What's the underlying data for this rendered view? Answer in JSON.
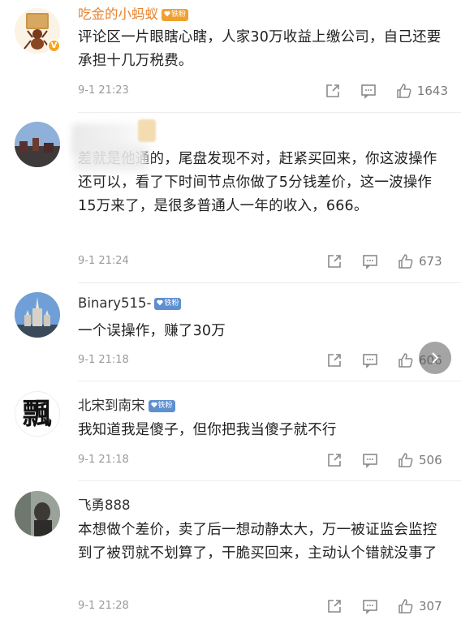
{
  "comments": [
    {
      "username": "吃金的小蚂蚁",
      "badge": "铁粉",
      "badge_color": "#f0a030",
      "text": "评论区一片眼瞎心瞎，人家30万收益上缴公司，自己还要承担十几万税费。",
      "time": "9-1 21:23",
      "likes": "1643",
      "verified": "V"
    },
    {
      "username": "",
      "text": "差就是他通的，尾盘发现不对，赶紧买回来，你这波操作还可以，看了下时间节点你做了5分钱差价，这一波操作15万来了，是很多普通人一年的收入，666。",
      "time": "9-1 21:24",
      "likes": "673"
    },
    {
      "username": "Binary515-",
      "badge": "铁粉",
      "badge_color": "#5e8fd1",
      "text": "一个误操作，赚了30万",
      "time": "9-1 21:18",
      "likes": "606"
    },
    {
      "username": "北宋到南宋",
      "badge": "铁粉",
      "badge_color": "#5e8fd1",
      "text": "我知道我是傻子，但你把我当傻子就不行",
      "time": "9-1 21:18",
      "likes": "506",
      "avatar_glyph": "飄"
    },
    {
      "username": "飞勇888",
      "text": "本想做个差价，卖了后一想动静太大，万一被证监会监控到了被罚就不划算了，干脆买回来，主动认个错就没事了",
      "time": "9-1 21:28",
      "likes": "307"
    }
  ]
}
